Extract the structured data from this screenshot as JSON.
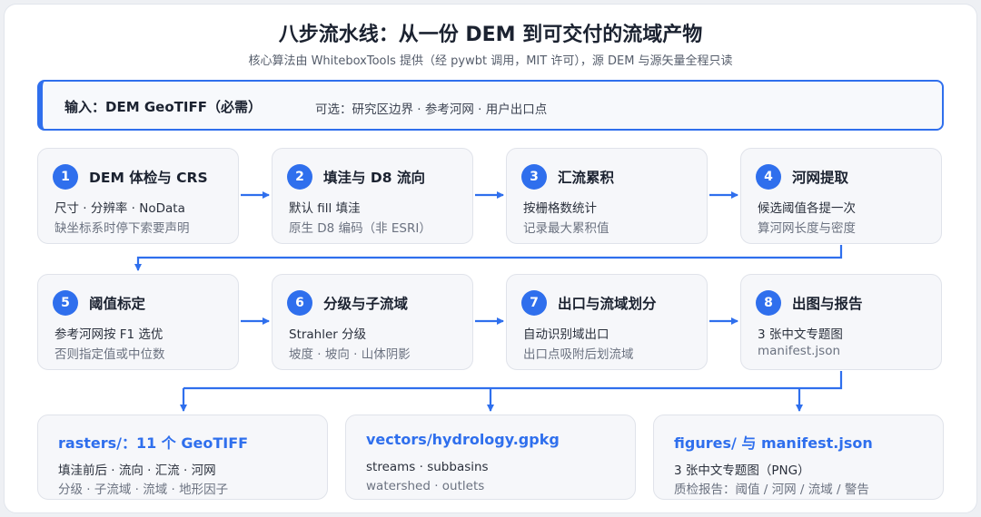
{
  "title": "八步流水线：从一份 DEM 到可交付的流域产物",
  "subtitle": "核心算法由 WhiteboxTools 提供（经 pywbt 调用，MIT 许可），源 DEM 与源矢量全程只读",
  "input": {
    "main": "输入：DEM GeoTIFF（必需）",
    "optional": "可选：研究区边界 · 参考河网 · 用户出口点"
  },
  "steps": [
    {
      "num": "1",
      "title": "DEM 体检与 CRS",
      "line1": "尺寸 · 分辨率 · NoData",
      "line2": "缺坐标系时停下索要声明"
    },
    {
      "num": "2",
      "title": "填洼与 D8 流向",
      "line1": "默认 fill 填洼",
      "line2": "原生 D8 编码（非 ESRI）"
    },
    {
      "num": "3",
      "title": "汇流累积",
      "line1": "按栅格数统计",
      "line2": "记录最大累积值"
    },
    {
      "num": "4",
      "title": "河网提取",
      "line1": "候选阈值各提一次",
      "line2": "算河网长度与密度"
    },
    {
      "num": "5",
      "title": "阈值标定",
      "line1": "参考河网按 F1 选优",
      "line2": "否则指定值或中位数"
    },
    {
      "num": "6",
      "title": "分级与子流域",
      "line1": "Strahler 分级",
      "line2": "坡度 · 坡向 · 山体阴影"
    },
    {
      "num": "7",
      "title": "出口与流域划分",
      "line1": "自动识别域出口",
      "line2": "出口点吸附后划流域"
    },
    {
      "num": "8",
      "title": "出图与报告",
      "line1": "3 张中文专题图",
      "line2": "manifest.json"
    }
  ],
  "outputs": [
    {
      "title": "rasters/：11 个 GeoTIFF",
      "line1": "填洼前后 · 流向 · 汇流 · 河网",
      "line2": "分级 · 子流域 · 流域 · 地形因子"
    },
    {
      "title": "vectors/hydrology.gpkg",
      "line1": "streams · subbasins",
      "line2": "watershed · outlets"
    },
    {
      "title": "figures/ 与 manifest.json",
      "line1": "3 张中文专题图（PNG）",
      "line2": "质检报告：阈值 / 河网 / 流域 / 警告"
    }
  ],
  "colors": {
    "accent": "#2f6fed",
    "text": "#1b2230",
    "muted": "#6b7280",
    "card": "#f6f7fa"
  }
}
